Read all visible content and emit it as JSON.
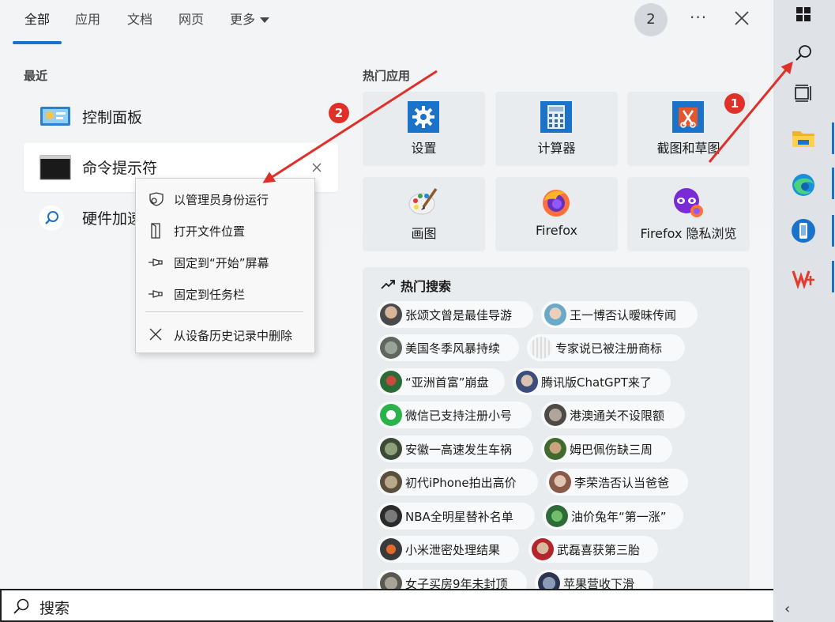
{
  "nav": {
    "tabs": [
      {
        "label": "全部"
      },
      {
        "label": "应用"
      },
      {
        "label": "文档"
      },
      {
        "label": "网页"
      },
      {
        "label": "更多"
      }
    ],
    "account_badge": "2",
    "more_dots": "···"
  },
  "recent": {
    "title": "最近",
    "items": [
      {
        "label": "控制面板",
        "icon": "control-panel-icon"
      },
      {
        "label": "命令提示符",
        "icon": "command-prompt-icon"
      },
      {
        "label": "硬件加速",
        "icon": "search-icon"
      }
    ]
  },
  "context_menu": {
    "items": [
      {
        "label": "以管理员身份运行",
        "icon": "shield-icon"
      },
      {
        "label": "打开文件位置",
        "icon": "open-folder-icon"
      },
      {
        "label": "固定到“开始”屏幕",
        "icon": "pin-icon"
      },
      {
        "label": "固定到任务栏",
        "icon": "pin-icon"
      },
      {
        "label": "从设备历史记录中删除",
        "icon": "close-icon"
      }
    ]
  },
  "top_apps": {
    "title": "热门应用",
    "apps": [
      {
        "label": "设置",
        "icon": "gear-icon"
      },
      {
        "label": "计算器",
        "icon": "calculator-icon"
      },
      {
        "label": "截图和草图",
        "icon": "snip-sketch-icon"
      },
      {
        "label": "画图",
        "icon": "paint-icon"
      },
      {
        "label": "Firefox",
        "icon": "firefox-icon"
      },
      {
        "label": "Firefox 隐私浏览",
        "icon": "firefox-private-icon"
      }
    ]
  },
  "hot_search": {
    "title": "热门搜索",
    "items": [
      {
        "label": "张颂文曾是最佳导游"
      },
      {
        "label": "王一博否认暧昧传闻"
      },
      {
        "label": "美国冬季风暴持续"
      },
      {
        "label": "专家说已被注册商标"
      },
      {
        "label": "“亚洲首富”崩盘"
      },
      {
        "label": "腾讯版ChatGPT来了"
      },
      {
        "label": "微信已支持注册小号"
      },
      {
        "label": "港澳通关不设限额"
      },
      {
        "label": "安徽一高速发生车祸"
      },
      {
        "label": "姆巴佩伤缺三周"
      },
      {
        "label": "初代iPhone拍出高价"
      },
      {
        "label": "李荣浩否认当爸爸"
      },
      {
        "label": "NBA全明星替补名单"
      },
      {
        "label": "油价兔年“第一涨”"
      },
      {
        "label": "小米泄密处理结果"
      },
      {
        "label": "武磊喜获第三胎"
      },
      {
        "label": "女子买房9年未封顶"
      },
      {
        "label": "苹果营收下滑"
      }
    ]
  },
  "search_bar": {
    "text": "搜索"
  },
  "taskbar": {
    "items": [
      {
        "icon": "windows-logo-icon"
      },
      {
        "icon": "search-icon"
      },
      {
        "icon": "task-view-icon"
      },
      {
        "icon": "file-explorer-icon"
      },
      {
        "icon": "edge-icon"
      },
      {
        "icon": "phone-link-icon"
      },
      {
        "icon": "wps-icon"
      }
    ],
    "chevron": "‹"
  },
  "annotations": {
    "marker_1": "1",
    "marker_2": "2"
  },
  "colors": {
    "accent": "#1a73c8",
    "marker": "#e0302a"
  }
}
